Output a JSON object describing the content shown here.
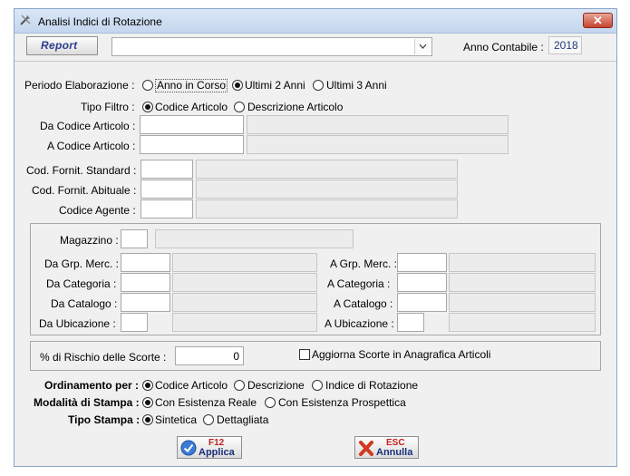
{
  "window": {
    "title": "Analisi Indici di Rotazione",
    "close_label": "✕"
  },
  "toolbar": {
    "report_label": "Report",
    "report_select_value": "",
    "anno_label": "Anno Contabile :",
    "anno_value": "2018"
  },
  "periodo": {
    "label": "Periodo Elaborazione :",
    "options": [
      "Anno in Corso",
      "Ultimi 2 Anni",
      "Ultimi 3 Anni"
    ],
    "selected": "Ultimi 2 Anni"
  },
  "tipo_filtro": {
    "label": "Tipo Filtro :",
    "options": [
      "Codice Articolo",
      "Descrizione Articolo"
    ],
    "selected": "Codice Articolo"
  },
  "articolo": {
    "da_label": "Da Codice Articolo :",
    "a_label": "A Codice Articolo :"
  },
  "fornitori": {
    "standard_label": "Cod. Fornit. Standard :",
    "abituale_label": "Cod. Fornit. Abituale :",
    "agente_label": "Codice Agente :"
  },
  "magazzino": {
    "magazzino_label": "Magazzino :",
    "da_grp_label": "Da Grp. Merc. :",
    "a_grp_label": "A Grp. Merc. :",
    "da_cat_label": "Da Categoria :",
    "a_cat_label": "A Categoria :",
    "da_catalogo_label": "Da Catalogo :",
    "a_catalogo_label": "A Catalogo :",
    "da_ubicazione_label": "Da Ubicazione :",
    "a_ubicazione_label": "A Ubicazione :"
  },
  "rischio": {
    "label": "% di Rischio delle Scorte :",
    "value": "0",
    "aggiorna_label": "Aggiorna Scorte in Anagrafica Articoli"
  },
  "ordinamento": {
    "label": "Ordinamento per :",
    "options": [
      "Codice Articolo",
      "Descrizione",
      "Indice di Rotazione"
    ],
    "selected": "Codice Articolo"
  },
  "modalita": {
    "label": "Modalità di Stampa :",
    "options": [
      "Con Esistenza Reale",
      "Con Esistenza Prospettica"
    ],
    "selected": "Con Esistenza Reale"
  },
  "tipo_stampa": {
    "label": "Tipo Stampa :",
    "options": [
      "Sintetica",
      "Dettagliata"
    ],
    "selected": "Sintetica"
  },
  "buttons": {
    "applica_key": "F12",
    "applica_label": "Applica",
    "annulla_key": "ESC",
    "annulla_label": "Annulla"
  }
}
